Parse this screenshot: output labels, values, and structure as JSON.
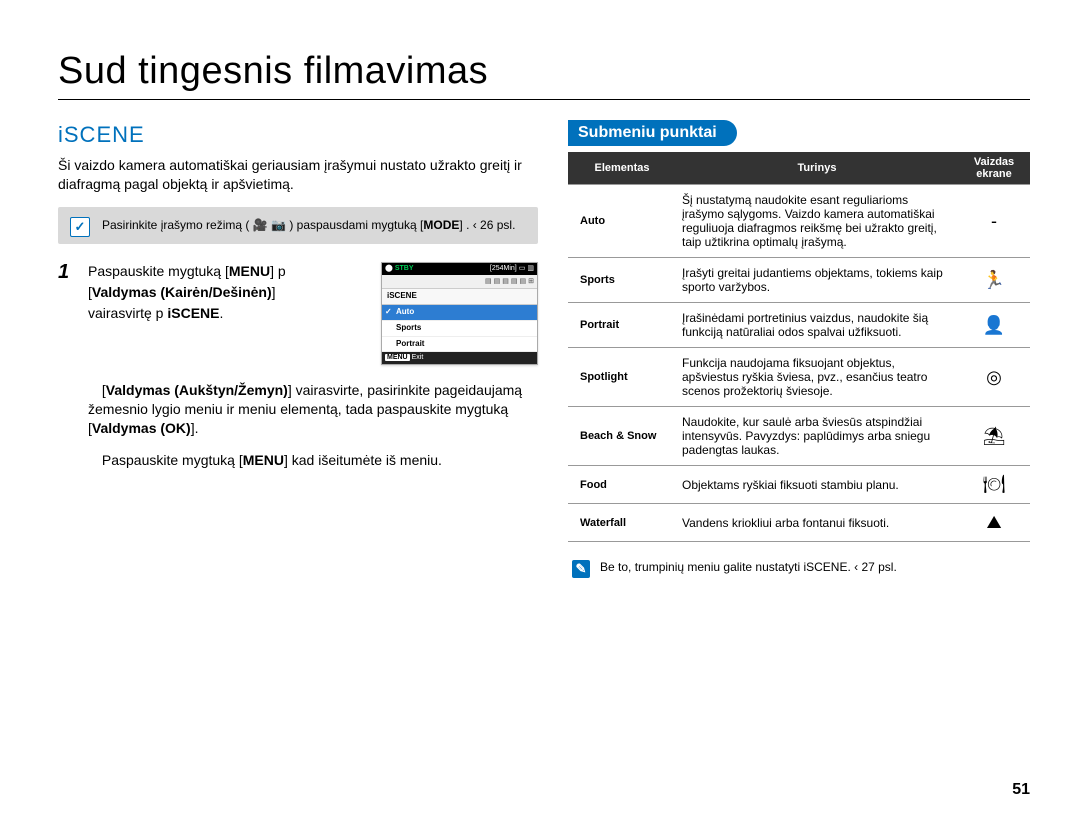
{
  "page": {
    "title": "Sud tingesnis filmavimas",
    "number": "51"
  },
  "section": {
    "heading": "iSCENE",
    "intro": "Ši vaizdo kamera automatiškai geriausiam įrašymui nustato užrakto greitį ir diafragmą pagal objektą ir apšvietimą."
  },
  "callout": {
    "text_pre": "Pasirinkite įrašymo režimą (",
    "text_post": ") paspausdami mygtuką ",
    "tag_mode": "MODE",
    "page_ref": ". ‹ 26 psl."
  },
  "step1": {
    "num": "1",
    "line1_pre": "Paspauskite mygtuką [",
    "line1_bold": "MENU",
    "line1_post": "]  p",
    "line2_bold": "Valdymas (Kairėn/Dešinėn)",
    "line2_post": "]",
    "line3_pre": "vairasvirtę  p ",
    "line3_bold": "iSCENE",
    "line3_end": "."
  },
  "step2": {
    "label_bold": "Valdymas (Aukštyn/Žemyn)",
    "label_post": "] vairasvirte, pasirinkite pageidaujamą žemesnio lygio meniu ir meniu elementą, tada paspauskite mygtuką [",
    "ok": "Valdymas (OK)",
    "end": "]."
  },
  "step3": {
    "pre": "Paspauskite mygtuką [",
    "bold": "MENU",
    "post": "] kad išeitumėte iš meniu."
  },
  "device": {
    "stby": "STBY",
    "time": "[254Min]",
    "title": "iSCENE",
    "items": [
      "Auto",
      "Sports",
      "Portrait"
    ],
    "exit": "Exit",
    "menu_tag": "MENU"
  },
  "submenu": {
    "heading": "Submeniu punktai",
    "hdr_element": "Elementas",
    "hdr_content": "Turinys",
    "hdr_icon_l1": "Vaizdas",
    "hdr_icon_l2": "ekrane",
    "rows": [
      {
        "el": "Auto",
        "txt": "Šį nustatymą naudokite esant reguliarioms įrašymo sąlygoms. Vaizdo kamera automatiškai reguliuoja diafragmos reikšmę bei užrakto greitį, taip užtikrina optimalų įrašymą.",
        "ic": "-"
      },
      {
        "el": "Sports",
        "txt": "Įrašyti greitai judantiems objektams, tokiems kaip sporto varžybos.",
        "ic": "🏃"
      },
      {
        "el": "Portrait",
        "txt": "Įrašinėdami portretinius vaizdus, naudokite šią funkciją natūraliai odos spalvai užfiksuoti.",
        "ic": "👤"
      },
      {
        "el": "Spotlight",
        "txt": "Funkcija naudojama fiksuojant objektus, apšviestus ryškia šviesa, pvz., esančius teatro scenos prožektorių šviesoje.",
        "ic": "◎"
      },
      {
        "el": "Beach & Snow",
        "txt": "Naudokite, kur saulė arba šviesūs atspindžiai intensyvūs. Pavyzdys: paplūdimys arba sniegu padengtas laukas.",
        "ic": "⛱"
      },
      {
        "el": "Food",
        "txt": "Objektams ryškiai fiksuoti stambiu planu.",
        "ic": "🍽"
      },
      {
        "el": "Waterfall",
        "txt": "Vandens kriokliui arba fontanui fiksuoti.",
        "ic": "⛰"
      }
    ],
    "note": "Be to, trumpinių meniu galite nustatyti iSCENE.  ‹  27 psl."
  }
}
